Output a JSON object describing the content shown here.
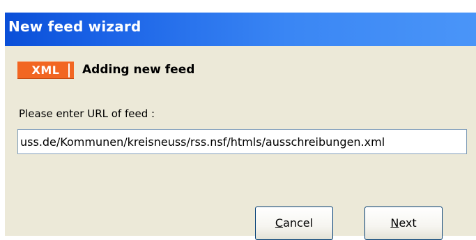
{
  "window": {
    "title": "New feed wizard"
  },
  "header": {
    "badge": "XML",
    "heading": "Adding new feed"
  },
  "form": {
    "prompt": "Please enter URL of feed :",
    "url_value": "uss.de/Kommunen/kreisneuss/rss.nsf/htmls/ausschreibungen.xml"
  },
  "buttons": {
    "cancel": {
      "mnemonic": "C",
      "rest": "ancel"
    },
    "next": {
      "mnemonic": "N",
      "rest": "ext"
    }
  },
  "colors": {
    "titlebar_start": "#0a4fd8",
    "titlebar_end": "#4a95f8",
    "badge": "#f26622",
    "dialog_bg": "#ece9d8"
  }
}
